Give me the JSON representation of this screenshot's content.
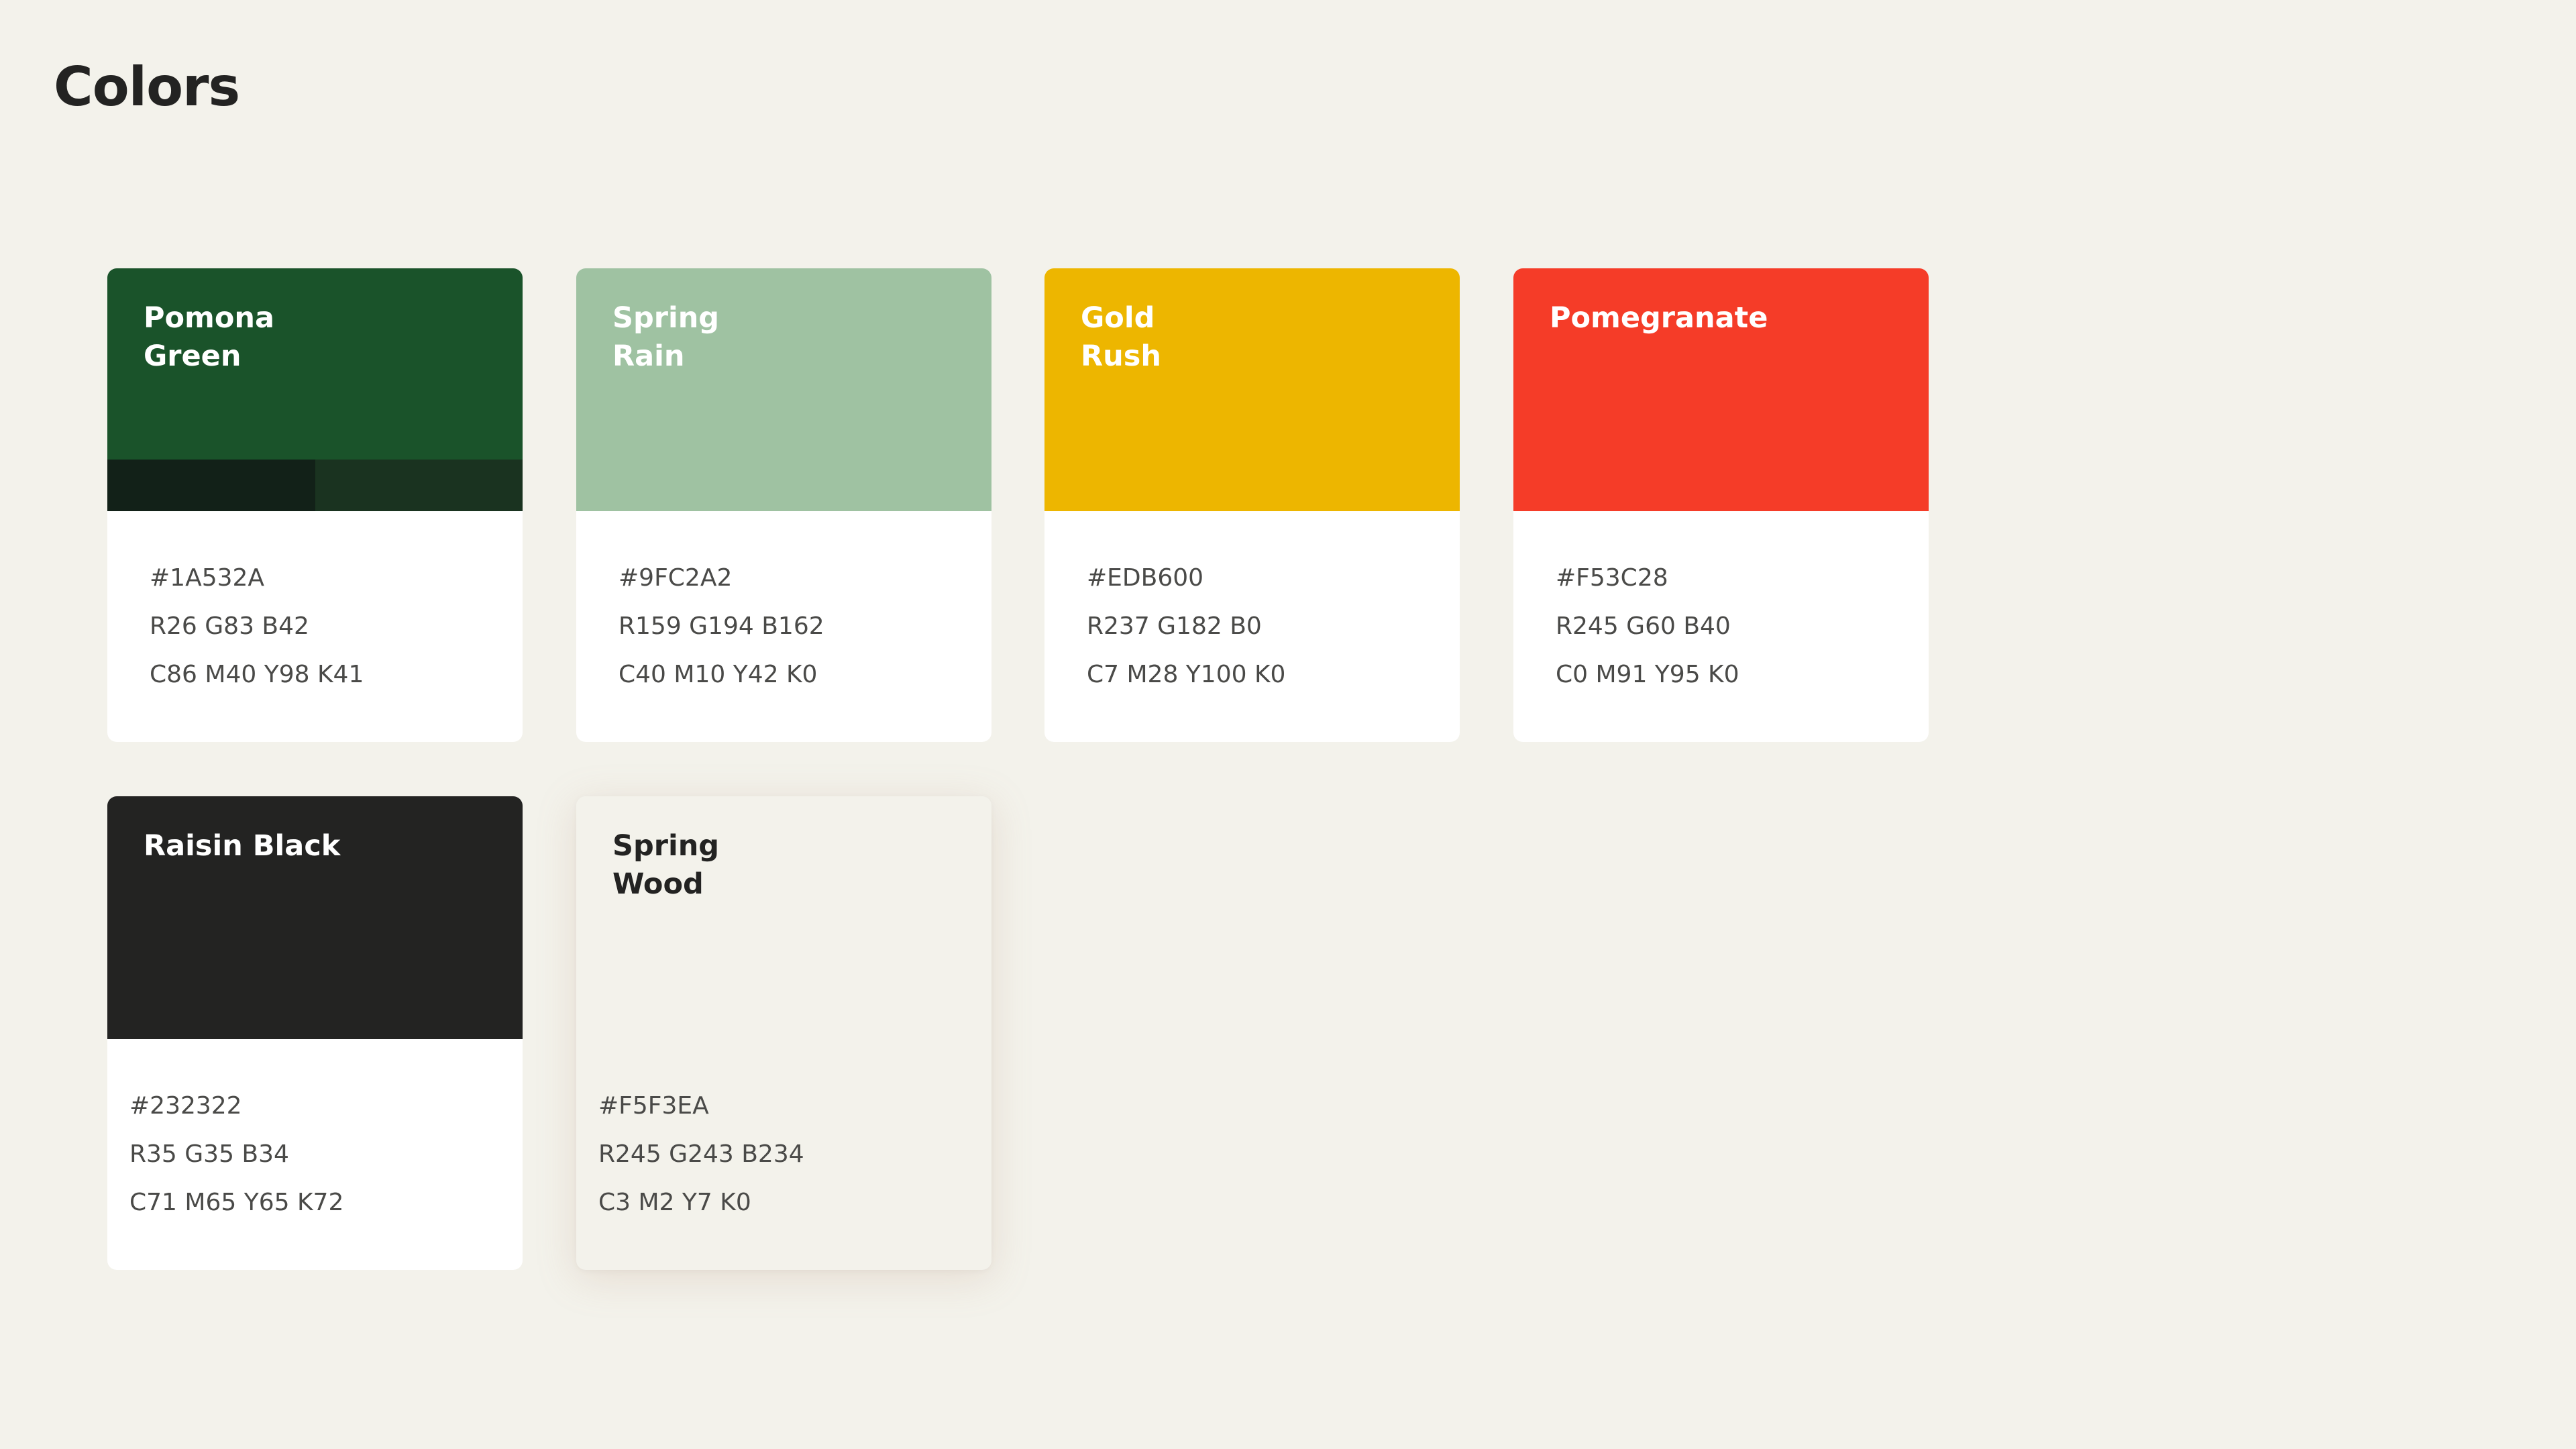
{
  "page": {
    "title": "Colors",
    "background": "#F3F2EB"
  },
  "colors": [
    {
      "name": "Pomona\nGreen",
      "swatch": "#1A532A",
      "shades": [
        "#122118",
        "#1A3320"
      ],
      "hex": "#1A532A",
      "rgb": "R26 G83 B42",
      "cmyk": "C86 M40 Y98 K41"
    },
    {
      "name": "Spring\nRain",
      "swatch": "#9FC2A2",
      "hex": "#9FC2A2",
      "rgb": "R159 G194 B162",
      "cmyk": "C40 M10 Y42 K0"
    },
    {
      "name": "Gold\nRush",
      "swatch": "#EDB600",
      "hex": "#EDB600",
      "rgb": "R237 G182 B0",
      "cmyk": "C7 M28 Y100 K0"
    },
    {
      "name": "Pomegranate",
      "swatch": "#F53C28",
      "hex": "#F53C28",
      "rgb": "R245 G60 B40",
      "cmyk": "C0 M91 Y95 K0"
    },
    {
      "name": "Raisin Black",
      "swatch": "#232322",
      "hex": "#232322",
      "rgb": "R35 G35 B34",
      "cmyk": "C71 M65 Y65 K72"
    },
    {
      "name": "Spring\nWood",
      "swatch": "#F3F2EB",
      "hex": "#F5F3EA",
      "rgb": "R245 G243 B234",
      "cmyk": "C3 M2 Y7 K0"
    }
  ]
}
